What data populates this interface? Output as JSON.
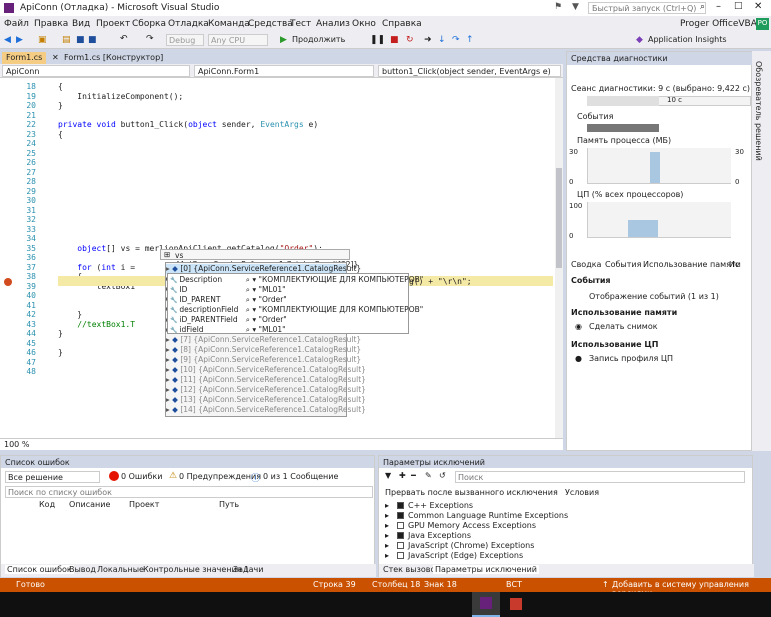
{
  "title": "ApiConn (Отладка) - Microsoft Visual Studio",
  "quick_launch": "Быстрый запуск (Ctrl+Q)",
  "menu": [
    "Файл",
    "Правка",
    "Вид",
    "Проект",
    "Сборка",
    "Отладка",
    "Команда",
    "Средства",
    "Тест",
    "Анализ",
    "Окно",
    "Справка"
  ],
  "user": {
    "name": "Proger OfficeVBA",
    "initials": "PO"
  },
  "toolbar": {
    "config": "Debug",
    "platform": "Any CPU",
    "continue": "Продолжить",
    "insights": "Application Insights"
  },
  "doc_tabs": [
    "Form1.cs",
    "Form1.cs [Конструктор]"
  ],
  "nav": {
    "project": "ApiConn",
    "class": "ApiConn.Form1",
    "member": "button1_Click(object sender, EventArgs e)"
  },
  "code_lines": [
    {
      "n": "18",
      "t": "{"
    },
    {
      "n": "19",
      "t": "    InitializeComponent();"
    },
    {
      "n": "20",
      "t": "}"
    },
    {
      "n": "21",
      "t": ""
    },
    {
      "n": "22",
      "t": "private void button1_Click(object sender, EventArgs e)"
    },
    {
      "n": "23",
      "t": "{"
    },
    {
      "n": "24",
      "t": ""
    },
    {
      "n": "25",
      "t": ""
    },
    {
      "n": "26",
      "t": ""
    },
    {
      "n": "27",
      "t": ""
    },
    {
      "n": "28",
      "t": ""
    },
    {
      "n": "29",
      "t": ""
    },
    {
      "n": "30",
      "t": ""
    },
    {
      "n": "31",
      "t": ""
    },
    {
      "n": "32",
      "t": ""
    },
    {
      "n": "33",
      "t": ""
    },
    {
      "n": "34",
      "t": ""
    },
    {
      "n": "35",
      "t": "    object[] vs = merlionApiClient.getCatalog(\"Order\");"
    },
    {
      "n": "36",
      "t": ""
    },
    {
      "n": "37",
      "t": "    for (int i = "
    },
    {
      "n": "38",
      "t": "    {"
    },
    {
      "n": "39",
      "t": "        textBox1"
    },
    {
      "n": "40",
      "t": ""
    },
    {
      "n": "41",
      "t": ""
    },
    {
      "n": "42",
      "t": "    }"
    },
    {
      "n": "43",
      "t": "    //textBox1.T"
    },
    {
      "n": "44",
      "t": "}"
    },
    {
      "n": "45",
      "t": ""
    },
    {
      "n": "46",
      "t": "}"
    },
    {
      "n": "47",
      "t": ""
    },
    {
      "n": "48",
      "t": ""
    }
  ],
  "line39_tail": "g() + \"\\r\\n\";",
  "zoom": "100 %",
  "datatip_header": "vs {ApiConn.ServiceReference1.CatalogResult[32]}",
  "datatip_rows": [
    "[0]  {ApiConn.ServiceReference1.CatalogResult}",
    "[1]",
    "[2]",
    "[3]",
    "[4]",
    "[5]",
    "[6]",
    "[7]  {ApiConn.ServiceReference1.CatalogResult}",
    "[8]  {ApiConn.ServiceReference1.CatalogResult}",
    "[9]  {ApiConn.ServiceReference1.CatalogResult}",
    "[10] {ApiConn.ServiceReference1.CatalogResult}",
    "[11] {ApiConn.ServiceReference1.CatalogResult}",
    "[12] {ApiConn.ServiceReference1.CatalogResult}",
    "[13] {ApiConn.ServiceReference1.CatalogResult}",
    "[14] {ApiConn.ServiceReference1.CatalogResult}"
  ],
  "subtip_rows": [
    {
      "name": "Description",
      "value": "\"КОМПЛЕКТУЮЩИЕ ДЛЯ КОМПЬЮТЕРОВ\""
    },
    {
      "name": "ID",
      "value": "\"ML01\""
    },
    {
      "name": "ID_PARENT",
      "value": "\"Order\""
    },
    {
      "name": "descriptionField",
      "value": "\"КОМПЛЕКТУЮЩИЕ ДЛЯ КОМПЬЮТЕРОВ\""
    },
    {
      "name": "iD_PARENTField",
      "value": "\"Order\""
    },
    {
      "name": "idField",
      "value": "\"ML01\""
    }
  ],
  "diag": {
    "title": "Средства диагностики",
    "session": "Сеанс диагностики: 9 с (выбрано: 9,422 с)",
    "time_tick": "10 с",
    "events": "События",
    "memory": "Память процесса (МБ)",
    "mem_max": "30",
    "mem_min": "0",
    "cpu": "ЦП (% всех процессоров)",
    "cpu_max": "100",
    "cpu_min": "0",
    "tabs": [
      "Сводка",
      "События",
      "Использование памяти",
      "Ис"
    ],
    "sec_events": "События",
    "show_events": "Отображение событий (1 из 1)",
    "sec_memory": "Использование памяти",
    "snapshot": "Сделать снимок",
    "sec_cpu": "Использование ЦП",
    "cpu_profile": "Запись профиля ЦП"
  },
  "sidebar_label": "Обозреватель решений",
  "errors": {
    "title": "Список ошибок",
    "scope": "Все решение",
    "errors_btn": "0 Ошибки",
    "warnings_btn": "0 Предупреждения",
    "messages_btn": "0 из 1 Сообщение",
    "search": "Поиск по списку ошибок",
    "cols": [
      "Код",
      "Описание",
      "Проект",
      "Путь"
    ],
    "bottom_tabs": [
      "Список ошибок",
      "Вывод",
      "Локальные",
      "Контрольные значения 1",
      "Задачи"
    ]
  },
  "exceptions": {
    "title": "Параметры исключений",
    "search": "Поиск",
    "col1": "Прервать после вызванного исключения",
    "col2": "Условия",
    "items": [
      "C++ Exceptions",
      "Common Language Runtime Exceptions",
      "GPU Memory Access Exceptions",
      "Java Exceptions",
      "JavaScript (Chrome) Exceptions",
      "JavaScript (Edge) Exceptions"
    ],
    "bottom_tabs": [
      "Стек вызовов",
      "Параметры исключений"
    ]
  },
  "status": {
    "ready": "Готово",
    "line": "Строка 39",
    "col": "Столбец 18",
    "ch": "Знак 18",
    "mode": "ВСТ",
    "vcs": "Добавить в систему управления версиями"
  }
}
